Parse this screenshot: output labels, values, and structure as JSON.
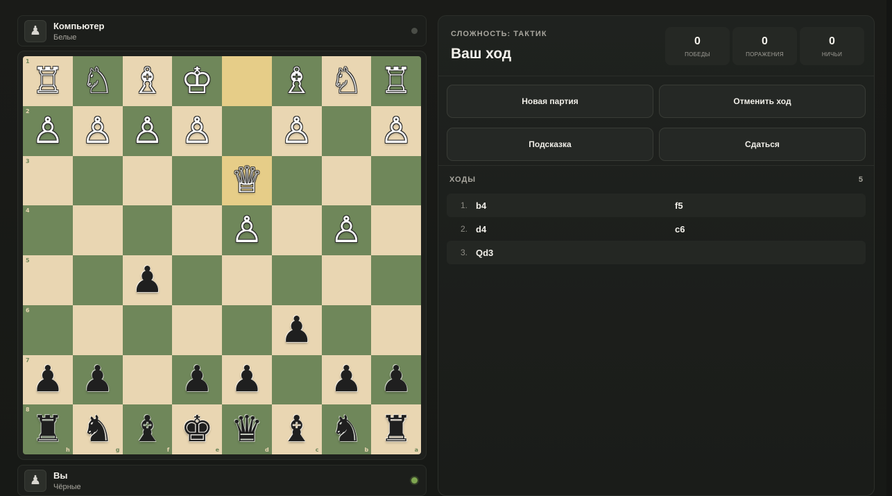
{
  "players": {
    "top": {
      "name": "Компьютер",
      "color": "Белые",
      "avatar_icon": "♟",
      "active": false
    },
    "bottom": {
      "name": "Вы",
      "color": "Чёрные",
      "avatar_icon": "♟",
      "active": true
    }
  },
  "board": {
    "orientation": "black-bottom",
    "rank_labels": [
      "1",
      "2",
      "3",
      "4",
      "5",
      "6",
      "7",
      "8"
    ],
    "file_labels": [
      "h",
      "g",
      "f",
      "e",
      "d",
      "c",
      "b",
      "a"
    ],
    "highlight": [
      [
        0,
        4
      ],
      [
        2,
        4
      ]
    ],
    "rows": [
      [
        "♖",
        "♘",
        "♗",
        "♔",
        "",
        "♗",
        "♘",
        "♖"
      ],
      [
        "♙",
        "♙",
        "♙",
        "♙",
        "",
        "♙",
        "",
        "♙"
      ],
      [
        "",
        "",
        "",
        "",
        "♕",
        "",
        "",
        ""
      ],
      [
        "",
        "",
        "",
        "",
        "♙",
        "",
        "♙",
        ""
      ],
      [
        "",
        "",
        "♟",
        "",
        "",
        "",
        "",
        ""
      ],
      [
        "",
        "",
        "",
        "",
        "",
        "♟",
        "",
        ""
      ],
      [
        "♟",
        "♟",
        "",
        "♟",
        "♟",
        "",
        "♟",
        "♟"
      ],
      [
        "♜",
        "♞",
        "♝",
        "♚",
        "♛",
        "♝",
        "♞",
        "♜"
      ]
    ],
    "colors": {
      "light": "#e9d6b2",
      "dark": "#6f875a",
      "highlight": "#e6cd88"
    }
  },
  "panel": {
    "difficulty": "СЛОЖНОСТЬ: ТАКТИК",
    "turn": "Ваш ход",
    "stats": [
      {
        "value": "0",
        "label": "ПОБЕДЫ"
      },
      {
        "value": "0",
        "label": "ПОРАЖЕНИЯ"
      },
      {
        "value": "0",
        "label": "НИЧЬИ"
      }
    ],
    "buttons": {
      "new_game": "Новая партия",
      "undo": "Отменить ход",
      "hint": "Подсказка",
      "resign": "Сдаться"
    },
    "moves_title": "ХОДЫ",
    "moves_count": "5",
    "moves": [
      {
        "num": "1.",
        "white": "b4",
        "black": "f5"
      },
      {
        "num": "2.",
        "white": "d4",
        "black": "c6"
      },
      {
        "num": "3.",
        "white": "Qd3",
        "black": ""
      }
    ]
  }
}
